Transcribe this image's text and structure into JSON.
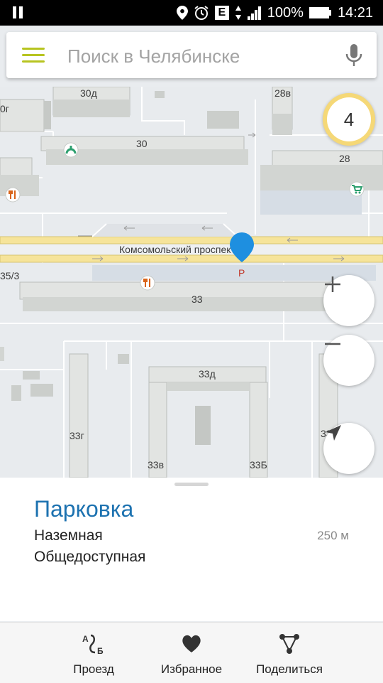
{
  "status_bar": {
    "battery": "100%",
    "time": "14:21",
    "network_badge": "E"
  },
  "search": {
    "placeholder": "Поиск в Челябинске"
  },
  "map": {
    "traffic_level": "4",
    "street": "Комсомольский проспект",
    "buildings": [
      "30д",
      "28в",
      "0г",
      "30",
      "28",
      "33",
      "35/3",
      "33д",
      "33г",
      "33в",
      "33Б",
      "33г"
    ],
    "parking_pin_letter": "P",
    "colors": {
      "road": "#f7e7a0",
      "road_edge": "#d9c36b",
      "pin": "#1e8fe0",
      "building": "#e1e3e1"
    }
  },
  "sheet": {
    "title": "Парковка",
    "type": "Наземная",
    "access": "Общедоступная",
    "distance": "250 м"
  },
  "bottom_nav": [
    {
      "label": "Проезд",
      "icon": "route-icon"
    },
    {
      "label": "Избранное",
      "icon": "heart-icon"
    },
    {
      "label": "Поделиться",
      "icon": "share-icon"
    }
  ]
}
